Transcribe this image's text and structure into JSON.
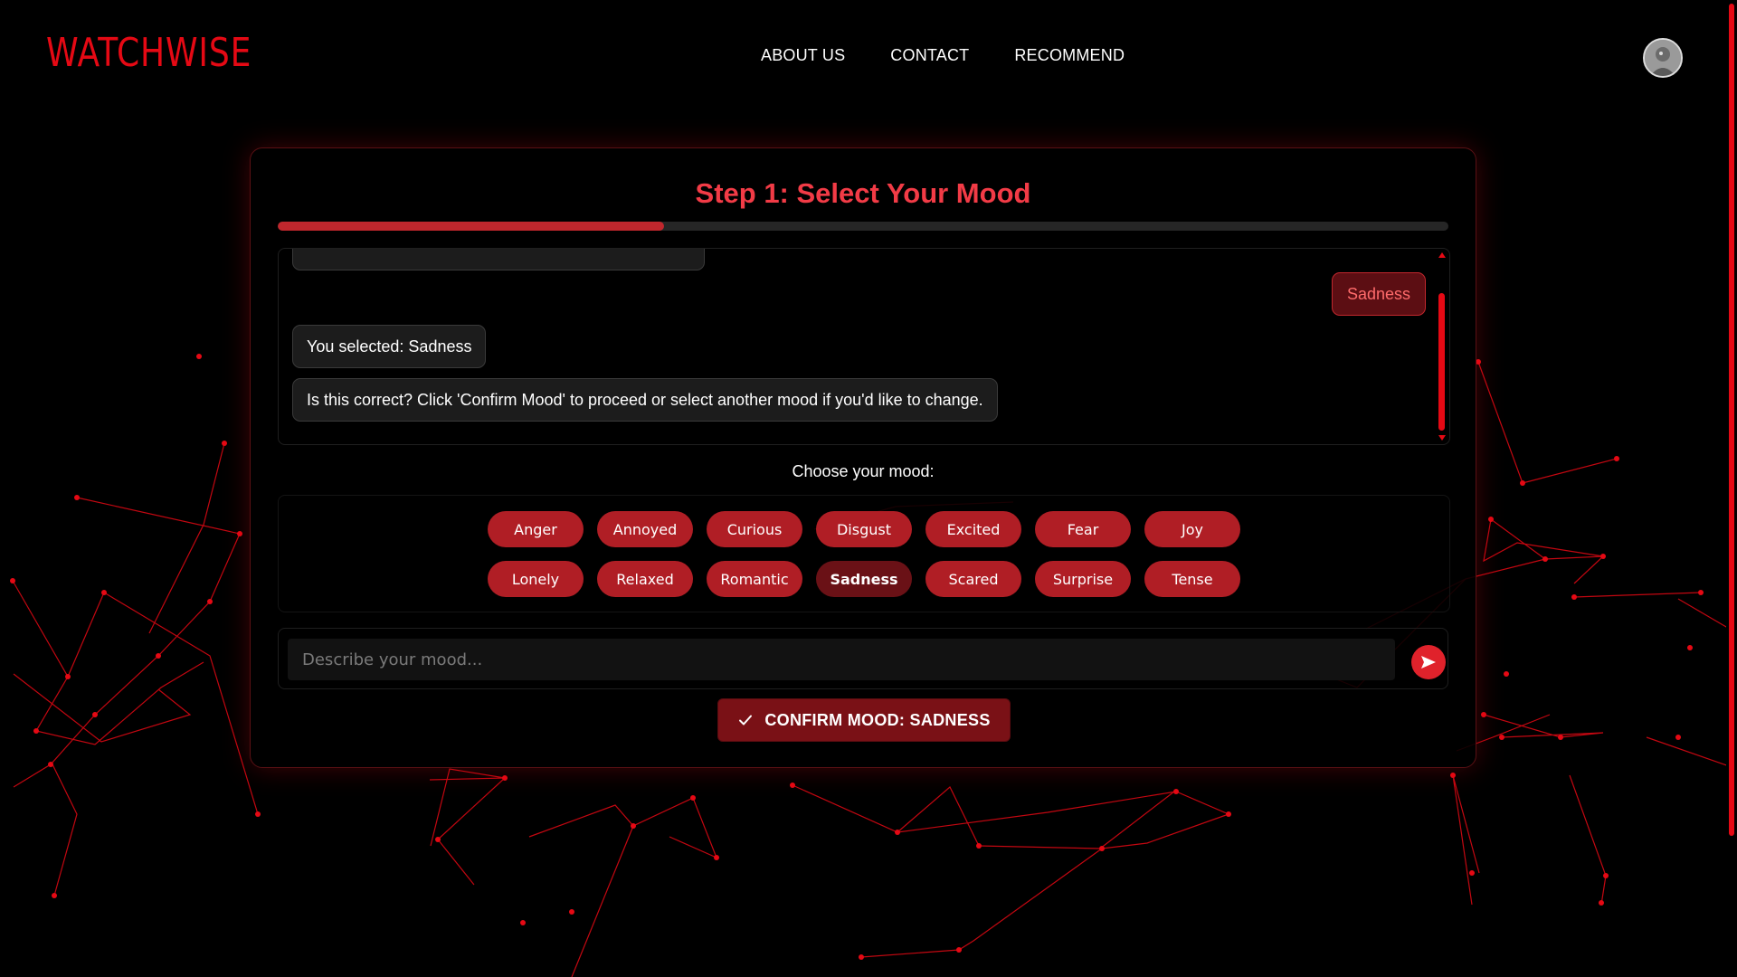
{
  "brand": "WATCHWISE",
  "nav": [
    "ABOUT US",
    "CONTACT",
    "RECOMMEND"
  ],
  "step": {
    "title": "Step 1: Select Your Mood",
    "progress_fraction": 0.33
  },
  "chat": {
    "user_message": "Sadness",
    "bot_messages": [
      "You selected: Sadness",
      "Is this correct? Click 'Confirm Mood' to proceed or select another mood if you'd like to change."
    ]
  },
  "moods": {
    "label": "Choose your mood:",
    "row1": [
      "Anger",
      "Annoyed",
      "Curious",
      "Disgust",
      "Excited",
      "Fear",
      "Joy"
    ],
    "row2": [
      "Lonely",
      "Relaxed",
      "Romantic",
      "Sadness",
      "Scared",
      "Surprise",
      "Tense"
    ],
    "selected": "Sadness"
  },
  "input": {
    "placeholder": "Describe your mood..."
  },
  "confirm_button": "CONFIRM MOOD: SADNESS",
  "icons": {
    "avatar": "user-avatar",
    "send": "send-arrow-icon",
    "check": "check-icon"
  },
  "colors": {
    "accent": "#e50914",
    "title": "#f23b46",
    "chip": "#b01e25",
    "chip_selected": "#6a1116",
    "progress_fill": "#c0272d"
  }
}
